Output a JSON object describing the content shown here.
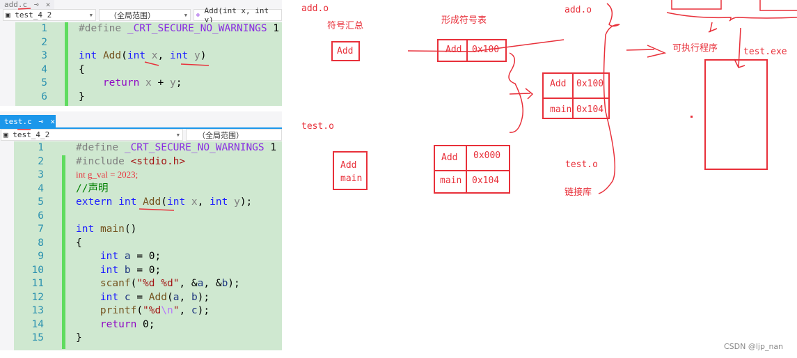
{
  "colors": {
    "annotation": "#e8303a",
    "code_bg": "#cfe8d0",
    "tab_active": "#1c97ea"
  },
  "top_editor": {
    "tab": {
      "label": "add.c",
      "pin_icon": "pin-icon",
      "close_icon": "close-icon"
    },
    "project_dropdown": "test_4_2",
    "scope_dropdown": "（全局范围）",
    "member_dropdown": "Add(int x, int y)",
    "lines": [
      {
        "n": "1",
        "segs": [
          [
            "#define ",
            "pp"
          ],
          [
            "_CRT_SECURE_NO_WARNINGS",
            "mac"
          ],
          [
            " 1",
            "pl"
          ]
        ]
      },
      {
        "n": "2",
        "segs": []
      },
      {
        "n": "3",
        "segs": [
          [
            "int",
            "kw"
          ],
          [
            " ",
            "pl"
          ],
          [
            "Add",
            "fn"
          ],
          [
            "(",
            "pl"
          ],
          [
            "int",
            "kw"
          ],
          [
            " x",
            "par"
          ],
          [
            ", ",
            "pl"
          ],
          [
            "int",
            "kw"
          ],
          [
            " y",
            "par"
          ],
          [
            ")",
            "pl"
          ]
        ]
      },
      {
        "n": "4",
        "segs": [
          [
            "{",
            "pl"
          ]
        ]
      },
      {
        "n": "5",
        "segs": [
          [
            "    ",
            "pl"
          ],
          [
            "return",
            "ctl"
          ],
          [
            " x",
            "par"
          ],
          [
            " + ",
            "pl"
          ],
          [
            "y",
            "par"
          ],
          [
            ";",
            "pl"
          ]
        ]
      },
      {
        "n": "6",
        "segs": [
          [
            "}",
            "pl"
          ]
        ]
      }
    ]
  },
  "bottom_editor": {
    "tab": {
      "label": "test.c",
      "pin_icon": "pin-icon",
      "close_icon": "close-icon"
    },
    "project_dropdown": "test_4_2",
    "scope_dropdown": "（全局范围）",
    "lines": [
      {
        "n": "1",
        "segs": [
          [
            "#define ",
            "pp"
          ],
          [
            "_CRT_SECURE_NO_WARNINGS",
            "mac"
          ],
          [
            " 1",
            "pl"
          ]
        ]
      },
      {
        "n": "2",
        "segs": [
          [
            "#include ",
            "pp"
          ],
          [
            "<stdio.h>",
            "str"
          ]
        ]
      },
      {
        "n": "3",
        "segs": [
          [
            "int g_val = 2023;",
            "hand"
          ]
        ]
      },
      {
        "n": "4",
        "segs": [
          [
            "//声明",
            "cm"
          ]
        ]
      },
      {
        "n": "5",
        "segs": [
          [
            "extern",
            "kw"
          ],
          [
            " ",
            "pl"
          ],
          [
            "int",
            "kw"
          ],
          [
            " ",
            "pl"
          ],
          [
            "Add",
            "fn"
          ],
          [
            "(",
            "pl"
          ],
          [
            "int",
            "kw"
          ],
          [
            " x",
            "par"
          ],
          [
            ", ",
            "pl"
          ],
          [
            "int",
            "kw"
          ],
          [
            " y",
            "par"
          ],
          [
            ");",
            "pl"
          ]
        ]
      },
      {
        "n": "6",
        "segs": []
      },
      {
        "n": "7",
        "segs": [
          [
            "int",
            "kw"
          ],
          [
            " ",
            "pl"
          ],
          [
            "main",
            "fn"
          ],
          [
            "()",
            "pl"
          ]
        ]
      },
      {
        "n": "8",
        "segs": [
          [
            "{",
            "pl"
          ]
        ]
      },
      {
        "n": "9",
        "segs": [
          [
            "    ",
            "pl"
          ],
          [
            "int",
            "kw"
          ],
          [
            " ",
            "pl"
          ],
          [
            "a",
            "var"
          ],
          [
            " = 0;",
            "pl"
          ]
        ]
      },
      {
        "n": "10",
        "segs": [
          [
            "    ",
            "pl"
          ],
          [
            "int",
            "kw"
          ],
          [
            " ",
            "pl"
          ],
          [
            "b",
            "var"
          ],
          [
            " = 0;",
            "pl"
          ]
        ]
      },
      {
        "n": "11",
        "segs": [
          [
            "    ",
            "pl"
          ],
          [
            "scanf",
            "fn"
          ],
          [
            "(",
            "pl"
          ],
          [
            "\"%d %d\"",
            "str"
          ],
          [
            ", &",
            "pl"
          ],
          [
            "a",
            "var"
          ],
          [
            ", &",
            "pl"
          ],
          [
            "b",
            "var"
          ],
          [
            ");",
            "pl"
          ]
        ]
      },
      {
        "n": "12",
        "segs": [
          [
            "    ",
            "pl"
          ],
          [
            "int",
            "kw"
          ],
          [
            " ",
            "pl"
          ],
          [
            "c",
            "var"
          ],
          [
            " = ",
            "pl"
          ],
          [
            "Add",
            "fn"
          ],
          [
            "(",
            "pl"
          ],
          [
            "a",
            "var"
          ],
          [
            ", ",
            "pl"
          ],
          [
            "b",
            "var"
          ],
          [
            ");",
            "pl"
          ]
        ]
      },
      {
        "n": "13",
        "segs": [
          [
            "    ",
            "pl"
          ],
          [
            "printf",
            "fn"
          ],
          [
            "(",
            "pl"
          ],
          [
            "\"%d",
            "str"
          ],
          [
            "\\n",
            "esc"
          ],
          [
            "\"",
            "str"
          ],
          [
            ", ",
            "pl"
          ],
          [
            "c",
            "var"
          ],
          [
            ");",
            "pl"
          ]
        ]
      },
      {
        "n": "14",
        "segs": [
          [
            "    ",
            "pl"
          ],
          [
            "return",
            "ctl"
          ],
          [
            " 0;",
            "pl"
          ]
        ]
      },
      {
        "n": "15",
        "segs": [
          [
            "}",
            "pl"
          ]
        ]
      }
    ]
  },
  "diagram": {
    "add_o_label": "add.o",
    "symbol_summary": "符号汇总",
    "add_box": "Add",
    "form_table": "形成符号表",
    "add_table": {
      "name": "Add",
      "addr": "0x100"
    },
    "add_o_label2": "add.o",
    "merged_table": [
      {
        "name": "Add",
        "addr": "0x100"
      },
      {
        "name": "main",
        "addr": "0x104"
      }
    ],
    "test_o_label": "test.o",
    "test_box": [
      "Add",
      "main"
    ],
    "test_table": [
      {
        "name": "Add",
        "addr": "0x000"
      },
      {
        "name": "main",
        "addr": "0x104"
      }
    ],
    "test_o_label2": "test.o",
    "link_lib": "链接库",
    "executable": "可执行程序",
    "exe_name": "test.exe"
  },
  "watermark": "CSDN @ljp_nan"
}
